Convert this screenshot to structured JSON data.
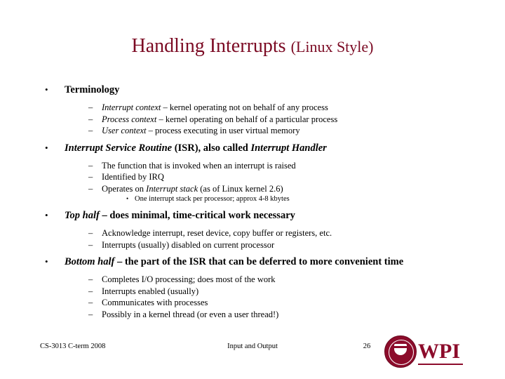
{
  "slide": {
    "title_main": "Handling Interrupts ",
    "title_sub": "(Linux Style)",
    "bullets": {
      "b1": "Terminology",
      "b1_s1_a": "Interrupt context",
      "b1_s1_b": " – kernel operating not on behalf of any process",
      "b1_s2_a": "Process context",
      "b1_s2_b": " – kernel operating on behalf of a particular process",
      "b1_s3_a": "User context",
      "b1_s3_b": " – process executing in user virtual memory",
      "b2_a": "Interrupt Service Routine",
      "b2_b": " (ISR), also called ",
      "b2_c": "Interrupt Handler",
      "b2_s1": "The function that is invoked when an interrupt is raised",
      "b2_s2": "Identified by IRQ",
      "b2_s3_a": "Operates on ",
      "b2_s3_b": "Interrupt stack",
      "b2_s3_c": " (as of Linux kernel 2.6)",
      "b2_s3_t1": "One interrupt stack per processor; approx 4-8 kbytes",
      "b3_a": "Top half",
      "b3_b": " – does minimal, time-critical work necessary",
      "b3_s1": "Acknowledge interrupt, reset device, copy buffer or registers, etc.",
      "b3_s2": "Interrupts (usually) disabled on current processor",
      "b4_a": "Bottom half",
      "b4_b": " – the part of the ISR that can be deferred to more convenient time",
      "b4_s1": "Completes I/O processing; does most of the work",
      "b4_s2": "Interrupts enabled (usually)",
      "b4_s3": "Communicates with processes",
      "b4_s4": "Possibly in a kernel thread (or even a user thread!)"
    }
  },
  "footer": {
    "left": "CS-3013 C-term 2008",
    "center": "Input and Output",
    "page": "26",
    "logo_text": "WPI"
  }
}
